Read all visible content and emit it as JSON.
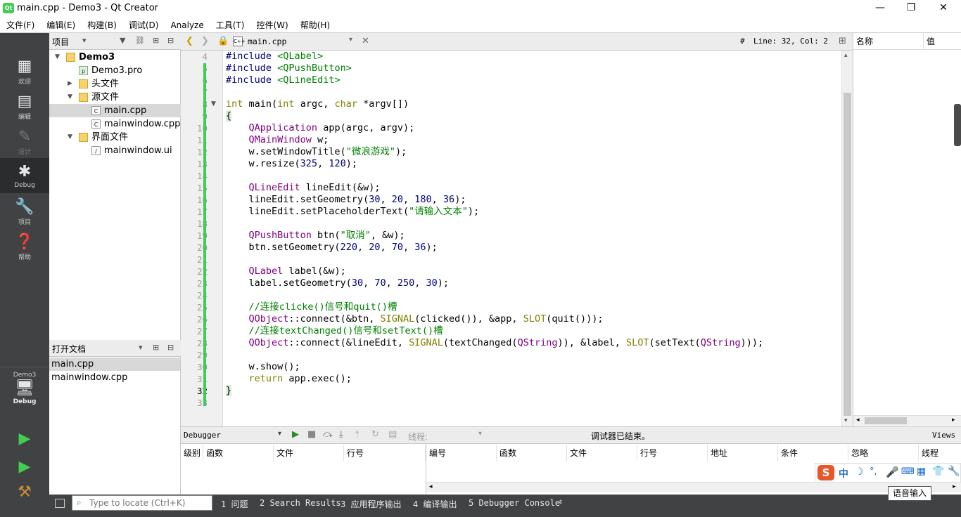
{
  "window": {
    "title": "main.cpp - Demo3 - Qt Creator",
    "min": "—",
    "max": "❐",
    "close": "✕"
  },
  "menu": [
    "文件(F)",
    "编辑(E)",
    "构建(B)",
    "调试(D)",
    "Analyze",
    "工具(T)",
    "控件(W)",
    "帮助(H)"
  ],
  "modes": [
    {
      "label": "欢迎",
      "icon": "grid-icon"
    },
    {
      "label": "编辑",
      "icon": "document-icon"
    },
    {
      "label": "设计",
      "icon": "pen-icon"
    },
    {
      "label": "Debug",
      "icon": "bug-icon"
    },
    {
      "label": "项目",
      "icon": "wrench-icon"
    },
    {
      "label": "帮助",
      "icon": "help-icon"
    }
  ],
  "kit": {
    "project": "Demo3",
    "config": "Debug"
  },
  "projects": {
    "header": "项目",
    "tree": [
      {
        "label": "Demo3",
        "level": 0,
        "expanded": true,
        "icon": "folder",
        "bold": true
      },
      {
        "label": "Demo3.pro",
        "level": 1,
        "icon": "pro"
      },
      {
        "label": "头文件",
        "level": 1,
        "expanded": false,
        "icon": "folder"
      },
      {
        "label": "源文件",
        "level": 1,
        "expanded": true,
        "icon": "folder"
      },
      {
        "label": "main.cpp",
        "level": 2,
        "icon": "cpp",
        "selected": true
      },
      {
        "label": "mainwindow.cpp",
        "level": 2,
        "icon": "cpp"
      },
      {
        "label": "界面文件",
        "level": 1,
        "expanded": true,
        "icon": "folder"
      },
      {
        "label": "mainwindow.ui",
        "level": 2,
        "icon": "ui"
      }
    ]
  },
  "open_docs": {
    "header": "打开文档",
    "items": [
      "main.cpp",
      "mainwindow.cpp"
    ]
  },
  "editor": {
    "file": "main.cpp",
    "cursor": "Line: 32, Col: 2",
    "hash": "#"
  },
  "code": {
    "start": 4,
    "lines": [
      "<span class=pp>#include</span> <span class=inc>&lt;QLabel&gt;</span>",
      "<span class=pp>#include</span> <span class=inc>&lt;QPushButton&gt;</span>",
      "<span class=pp>#include</span> <span class=inc>&lt;QLineEdit&gt;</span>",
      "",
      "<span class=kw>int</span> main(<span class=kw>int</span> argc, <span class=kw>char</span> *argv[])",
      "<span style='background:#d8f0d8'>{</span>",
      "    <span class=ty>QApplication</span> app(argc, argv);",
      "    <span class=ty>QMainWindow</span> w;",
      "    w.setWindowTitle(<span class=str>\"微浪游戏\"</span>);",
      "    w.resize(<span class=num>325</span>, <span class=num>120</span>);",
      "",
      "    <span class=ty>QLineEdit</span> lineEdit(&amp;w);",
      "    lineEdit.setGeometry(<span class=num>30</span>, <span class=num>20</span>, <span class=num>180</span>, <span class=num>36</span>);",
      "    lineEdit.setPlaceholderText(<span class=str>\"请输入文本\"</span>);",
      "",
      "    <span class=ty>QPushButton</span> btn(<span class=str>\"取消\"</span>, &amp;w);",
      "    btn.setGeometry(<span class=num>220</span>, <span class=num>20</span>, <span class=num>70</span>, <span class=num>36</span>);",
      "",
      "    <span class=ty>QLabel</span> label(&amp;w);",
      "    label.setGeometry(<span class=num>30</span>, <span class=num>70</span>, <span class=num>250</span>, <span class=num>30</span>);",
      "",
      "    <span class=cm>//连接clicke()信号和quit()槽</span>",
      "    <span class=ty>QObject</span>::connect(&amp;btn, <span class=mac>SIGNAL</span>(clicked()), &amp;app, <span class=mac>SLOT</span>(quit()));",
      "    <span class=cm>//连接textChanged()信号和setText()槽</span>",
      "    <span class=ty>QObject</span>::connect(&amp;lineEdit, <span class=mac>SIGNAL</span>(textChanged(<span class=ty>QString</span>)), &amp;label, <span class=mac>SLOT</span>(setText(<span class=ty>QString</span>)));",
      "",
      "    w.show();",
      "    <span class=kw>return</span> app.exec();",
      "<span style='background:#d8f0d8'>}</span>",
      ""
    ]
  },
  "locals": {
    "name_col": "名称",
    "value_col": "值"
  },
  "debugger": {
    "selector": "Debugger",
    "thread_label": "线程:",
    "status": "调试器已结束。",
    "views": "Views",
    "stack_cols": [
      "级别",
      "函数",
      "文件",
      "行号"
    ],
    "bp_cols": [
      "编号",
      "函数",
      "文件",
      "行号",
      "地址",
      "条件",
      "忽略",
      "线程"
    ]
  },
  "status": {
    "locate_placeholder": "Type to locate (Ctrl+K)",
    "tabs": [
      "1 问题",
      "2 Search Results",
      "3 应用程序输出",
      "4 编译输出",
      "5 Debugger Console"
    ]
  },
  "ime": {
    "brand": "S",
    "lang": "中",
    "tooltip": "语音输入"
  }
}
